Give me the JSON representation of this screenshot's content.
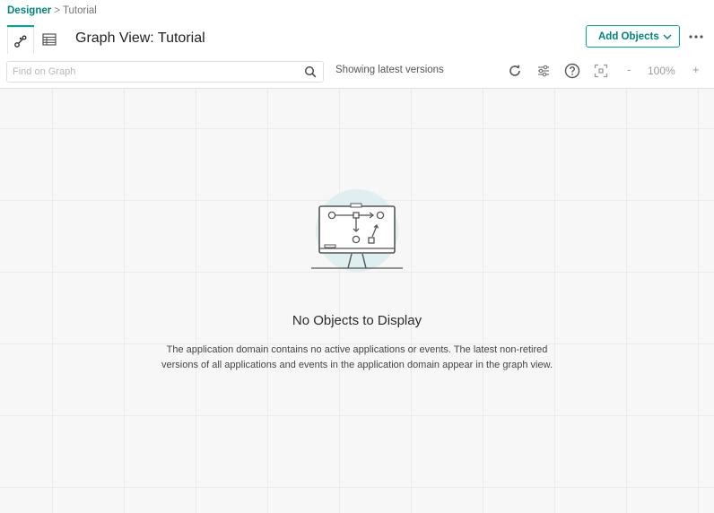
{
  "breadcrumb": {
    "root": "Designer",
    "separator": ">",
    "current": "Tutorial"
  },
  "header": {
    "title": "Graph View: Tutorial",
    "add_objects_label": "Add Objects"
  },
  "view_tabs": [
    {
      "name": "graph-view",
      "icon": "graph-icon",
      "active": true
    },
    {
      "name": "table-view",
      "icon": "table-icon",
      "active": false
    }
  ],
  "toolbar": {
    "search_placeholder": "Find on Graph",
    "search_value": "",
    "versions_text": "Showing latest versions",
    "zoom_minus": "-",
    "zoom_level": "100%",
    "zoom_plus": "+"
  },
  "empty_state": {
    "title": "No Objects to Display",
    "description": "The application domain contains no active applications or events. The latest non-retired versions of all applications and events in the application domain appear in the graph view."
  },
  "colors": {
    "accent": "#00a89a",
    "accent_text": "#00857a",
    "canvas_bg": "#f7f7f7"
  }
}
